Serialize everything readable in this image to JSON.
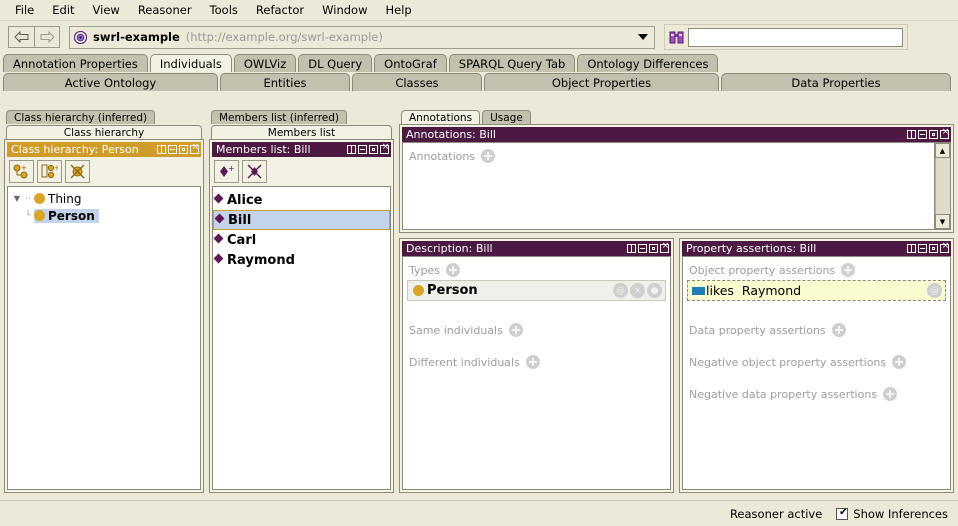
{
  "menu": {
    "items": [
      "File",
      "Edit",
      "View",
      "Reasoner",
      "Tools",
      "Refactor",
      "Window",
      "Help"
    ]
  },
  "toolbar": {
    "back_icon": "back-arrow-icon",
    "forward_icon": "forward-arrow-icon",
    "ontology_name": "swrl-example",
    "ontology_uri": "(http://example.org/swrl-example)",
    "search_placeholder": "",
    "search_value": ""
  },
  "tabs_row1": [
    {
      "label": "Annotation Properties",
      "selected": false
    },
    {
      "label": "Individuals",
      "selected": true
    },
    {
      "label": "OWLViz",
      "selected": false
    },
    {
      "label": "DL Query",
      "selected": false
    },
    {
      "label": "OntoGraf",
      "selected": false
    },
    {
      "label": "SPARQL Query Tab",
      "selected": false
    },
    {
      "label": "Ontology Differences",
      "selected": false
    }
  ],
  "tabs_row2": [
    {
      "label": "Active Ontology",
      "selected": false
    },
    {
      "label": "Entities",
      "selected": false
    },
    {
      "label": "Classes",
      "selected": false
    },
    {
      "label": "Object Properties",
      "selected": false
    },
    {
      "label": "Data Properties",
      "selected": false
    }
  ],
  "class_hierarchy": {
    "subtab_inferred": "Class hierarchy (inferred)",
    "subtab_plain": "Class hierarchy",
    "panel_title": "Class hierarchy: Person",
    "buttons": [
      "add-subclass-icon",
      "add-sibling-class-icon",
      "delete-class-icon"
    ],
    "tree": [
      {
        "label": "Thing",
        "level": 0,
        "selected": false,
        "expanded": true
      },
      {
        "label": "Person",
        "level": 1,
        "selected": true,
        "expanded": false
      }
    ]
  },
  "members_list": {
    "subtab_inferred": "Members list (inferred)",
    "subtab_plain": "Members list",
    "panel_title": "Members list: Bill",
    "buttons": [
      "add-individual-icon",
      "delete-individual-icon"
    ],
    "items": [
      {
        "label": "Alice",
        "selected": false
      },
      {
        "label": "Bill",
        "selected": true
      },
      {
        "label": "Carl",
        "selected": false
      },
      {
        "label": "Raymond",
        "selected": false
      }
    ]
  },
  "annotations": {
    "tabs": [
      {
        "label": "Annotations",
        "selected": true
      },
      {
        "label": "Usage",
        "selected": false
      }
    ],
    "panel_title": "Annotations: Bill",
    "section_label": "Annotations"
  },
  "description": {
    "panel_title": "Description: Bill",
    "types_label": "Types",
    "types_items": [
      {
        "label": "Person",
        "actions": [
          "@",
          "×",
          "●"
        ]
      }
    ],
    "same_individuals_label": "Same individuals",
    "different_individuals_label": "Different individuals"
  },
  "property_assertions": {
    "panel_title": "Property assertions: Bill",
    "object_property_label": "Object property assertions",
    "object_property_items": [
      {
        "property": "likes",
        "value": "Raymond",
        "inferred": true,
        "action": "@"
      }
    ],
    "data_property_label": "Data property assertions",
    "negative_object_property_label": "Negative object property assertions",
    "negative_data_property_label": "Negative data property assertions"
  },
  "status": {
    "reasoner_text": "Reasoner active",
    "show_inferences_label": "Show Inferences",
    "show_inferences_checked": true
  },
  "colors": {
    "panel_title_bg": "#4b1942",
    "class_panel_title_bg": "#cf9c2a",
    "selection_blue": "#c3d4ea",
    "selection_border": "#cf9c2a",
    "class_dot": "#d9a528",
    "individual_diamond": "#5b1a57",
    "inferred_row_bg": "#fbfbd2",
    "object_property_icon": "#1f7fb5",
    "window_bg": "#ece9d8"
  }
}
